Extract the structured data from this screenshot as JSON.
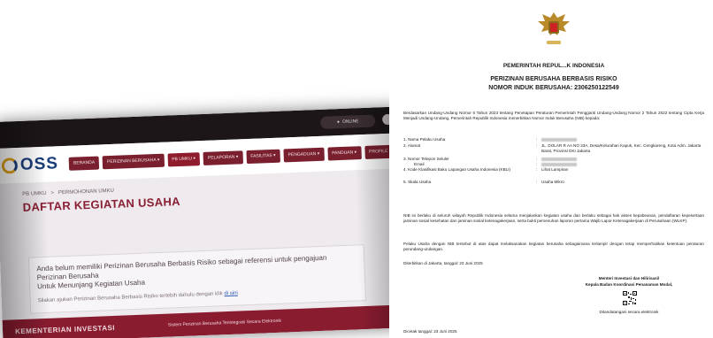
{
  "oss": {
    "logo": "OSS",
    "user_label": "ONLINE",
    "nav": [
      {
        "label": "BERANDA"
      },
      {
        "label": "PERIZINAN BERUSAHA ▾"
      },
      {
        "label": "PB UMKU ▾"
      },
      {
        "label": "PELAPORAN ▾"
      },
      {
        "label": "FASILITAS ▾"
      },
      {
        "label": "PENGADUAN ▾"
      },
      {
        "label": "PANDUAN ▾"
      },
      {
        "label": "PROFILE ▾"
      }
    ],
    "breadcrumb": [
      "PB UMKU",
      ">",
      "PERMOHONAN UMKU"
    ],
    "page_title": "DAFTAR KEGIATAN USAHA",
    "notice_line1": "Anda belum memiliki Perizinan Berusaha Berbasis Risiko sebagai referensi untuk pengajuan Perizinan Berusaha",
    "notice_line2": "Untuk Menunjang Kegiatan Usaha",
    "notice_hint": "Silakan ajukan Perizinan Berusaha Berbasis Risiko terlebih dahulu dengan klik",
    "notice_link": "di sini",
    "footer_brand": "KEMENTERIAN INVESTASI",
    "footer_note": "Sistem Perizinan Berusaha Terintegrasi Secara Elektronik"
  },
  "doc": {
    "gov": "PEMERINTAH REPUL...K INDONESIA",
    "title1": "PERIZINAN BERUSAHA BERBASIS RISIKO",
    "title2": "NOMOR INDUK BERUSAHA: 2306250122549",
    "intro": "Berdasarkan Undang-Undang Nomor 6 Tahun 2023 tentang Penetapan Peraturan Pemerintah Pengganti Undang-Undang Nomor 2 Tahun 2022 tentang Cipta Kerja Menjadi Undang-Undang, Pemerintah Republik Indonesia menerbitkan Nomor Induk Berusaha (NIB) kepada:",
    "fields": [
      {
        "label": "1. Nama Pelaku Usaha",
        "value": ""
      },
      {
        "label": "2. Alamat",
        "value": "JL. DOLAR R AA NO 33A, Desa/Kelurahan Kapuk, Kec. Cengkareng, Kota Adm. Jakarta Barat, Provinsi DKI Jakarta"
      },
      {
        "label": "3. Nomor Telepon Seluler",
        "value": ""
      },
      {
        "label": "Email",
        "value": ""
      },
      {
        "label": "4. Kode Klasifikasi Baku Lapangan Usaha Indonesia (KBLI)",
        "value": "Lihat Lampiran"
      },
      {
        "label": "5. Skala Usaha",
        "value": "Usaha Mikro"
      }
    ],
    "p1": "NIB ini berlaku di seluruh wilayah Republik Indonesia selama menjalankan kegiatan usaha dan berlaku sebagai hak akses kepabeanan, pendaftaran kepesertaan jaminan sosial kesehatan dan jaminan sosial ketenagakerjaan, serta bukti pemenuhan laporan pertama Wajib Lapor Ketenagakerjaan di Perusahaan (WLKP).",
    "p2": "Pelaku Usaha dengan NIB tersebut di atas dapat melaksanakan kegiatan berusaha sebagaimana terlampir dengan tetap memperhatikan ketentuan peraturan perundang-undangan.",
    "place": "Diterbitkan di Jakarta, tanggal: 23 Juni 2025",
    "signer1": "Menteri Investasi dan Hilirisasi/",
    "signer2": "Kepala Badan Koordinasi Penanaman Modal,",
    "esign": "Ditandatangani secara elektronik",
    "printed": "Dicetak tanggal: 23 Juni 2025"
  },
  "colors": {
    "oss_maroon": "#8a1f33",
    "oss_blue": "#1b3e7a",
    "oss_gold": "#e0a21c"
  }
}
